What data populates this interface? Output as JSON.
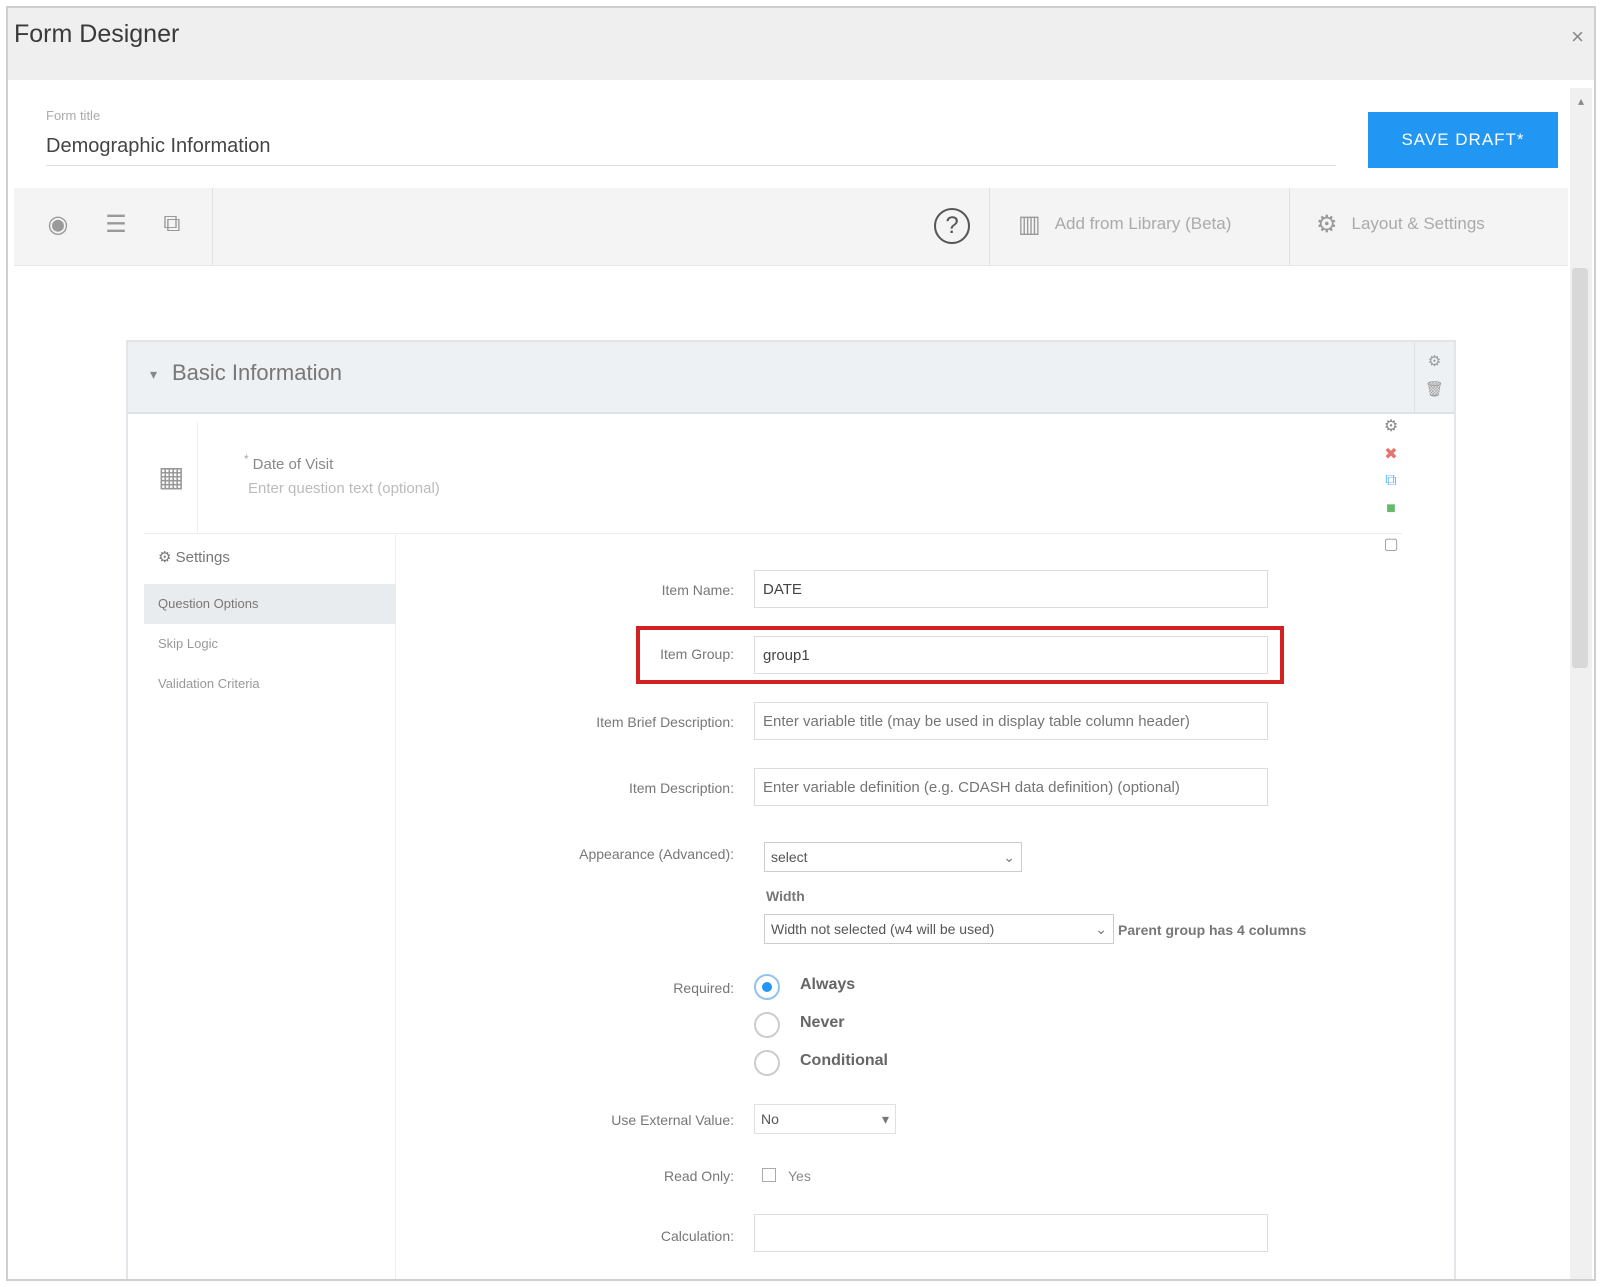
{
  "window": {
    "title": "Form Designer",
    "close": "×"
  },
  "header": {
    "form_title_label": "Form title",
    "form_title_value": "Demographic Information",
    "save_button": "SAVE DRAFT*"
  },
  "toolbar": {
    "help": "?",
    "add_from_library": "Add from Library (Beta)",
    "layout_settings": "Layout & Settings"
  },
  "section": {
    "title": "Basic Information"
  },
  "question": {
    "label": "Date of Visit",
    "required_mark": "*",
    "placeholder": "Enter question text (optional)"
  },
  "left_nav": {
    "settings": "Settings",
    "items": [
      "Question Options",
      "Skip Logic",
      "Validation Criteria"
    ]
  },
  "fields": {
    "item_name_label": "Item Name:",
    "item_name_value": "DATE",
    "item_group_label": "Item Group:",
    "item_group_value": "group1",
    "brief_desc_label": "Item Brief Description:",
    "brief_desc_placeholder": "Enter variable title (may be used in display table column header)",
    "description_label": "Item Description:",
    "description_placeholder": "Enter variable definition (e.g. CDASH data definition) (optional)",
    "appearance_label": "Appearance (Advanced):",
    "appearance_value": "select",
    "width_label": "Width",
    "width_value": "Width not selected (w4 will be used)",
    "width_note": "Parent group has 4 columns",
    "required_label": "Required:",
    "required_options": [
      "Always",
      "Never",
      "Conditional"
    ],
    "external_label": "Use External Value:",
    "external_value": "No",
    "read_only_label": "Read Only:",
    "read_only_option": "Yes",
    "calculation_label": "Calculation:"
  }
}
